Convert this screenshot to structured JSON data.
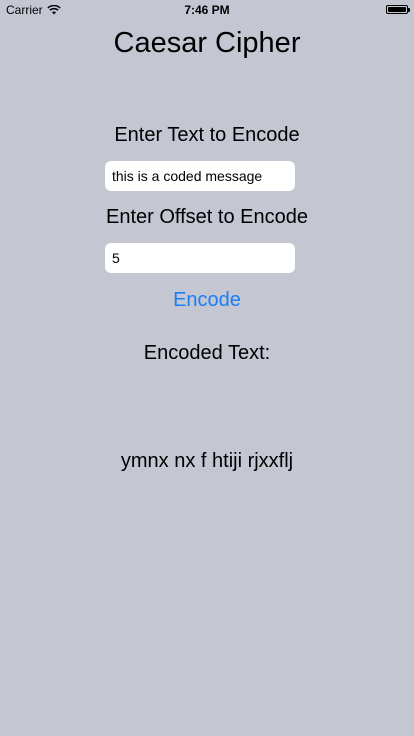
{
  "status_bar": {
    "carrier": "Carrier",
    "wifi_icon": "wifi-icon",
    "time": "7:46 PM",
    "battery_icon": "battery-icon",
    "battery_level": 1.0
  },
  "screen": {
    "title": "Caesar Cipher",
    "text_label": "Enter Text to Encode",
    "text_value": "this is a coded message",
    "offset_label": "Enter Offset to Encode",
    "offset_value": "5",
    "encode_button_label": "Encode",
    "encoded_label": "Encoded Text:",
    "encoded_result": "ymnx nx f htiji rjxxflj"
  },
  "colors": {
    "background": "#c4c6d2",
    "accent": "#1a7ef5",
    "field_background": "#ffffff"
  }
}
